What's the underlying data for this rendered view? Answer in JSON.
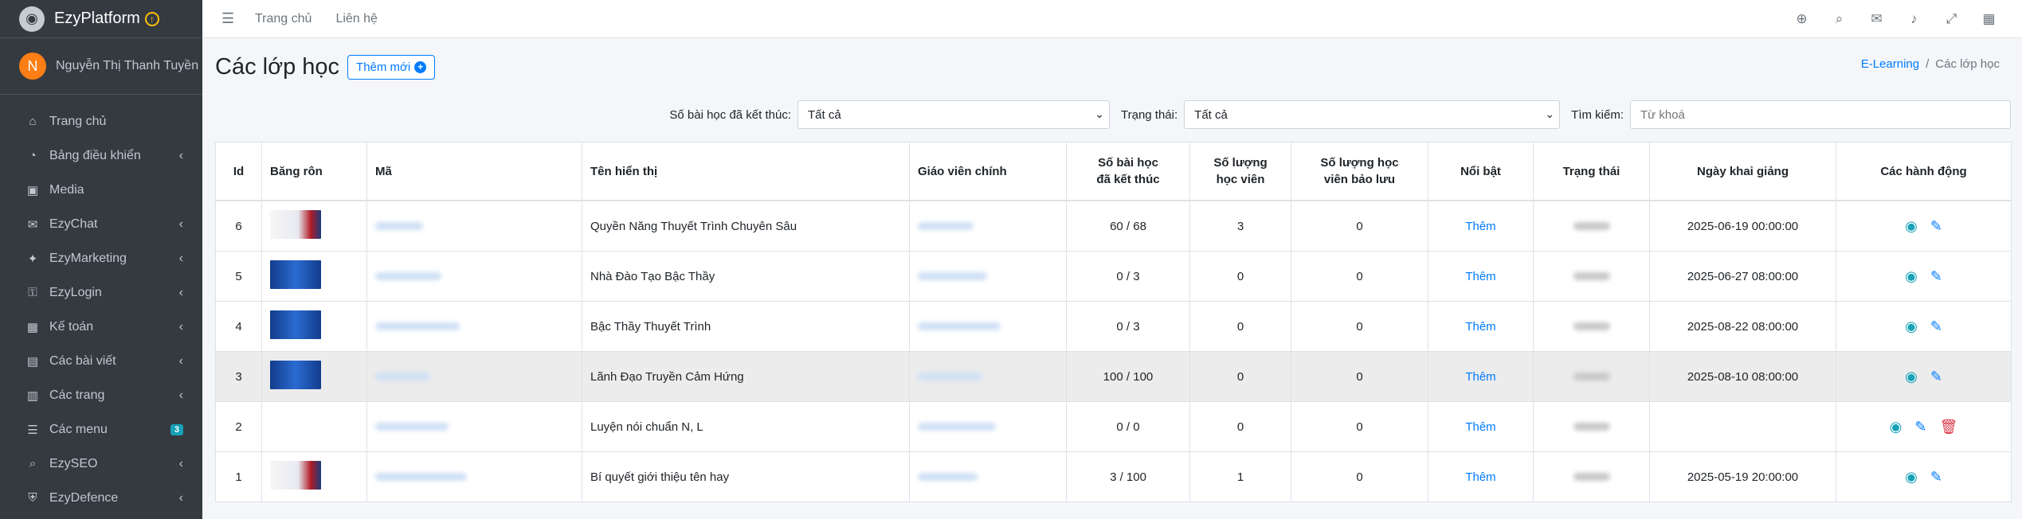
{
  "brand": {
    "name": "EzyPlatform",
    "badge": "↑"
  },
  "user": {
    "initial": "N",
    "name": "Nguyễn Thị Thanh Tuyền"
  },
  "sidebar": {
    "items": [
      {
        "label": "Trang chủ",
        "icon": "home-icon",
        "glyph": "⌂",
        "chevron": false
      },
      {
        "label": "Bảng điều khiển",
        "icon": "dashboard-icon",
        "glyph": "◔",
        "chevron": true
      },
      {
        "label": "Media",
        "icon": "image-icon",
        "glyph": "▣",
        "chevron": false
      },
      {
        "label": "EzyChat",
        "icon": "chat-icon",
        "glyph": "✉",
        "chevron": true
      },
      {
        "label": "EzyMarketing",
        "icon": "megaphone-icon",
        "glyph": "✦",
        "chevron": true
      },
      {
        "label": "EzyLogin",
        "icon": "user-lock-icon",
        "glyph": "⚿",
        "chevron": true
      },
      {
        "label": "Kế toán",
        "icon": "calculator-icon",
        "glyph": "▦",
        "chevron": true
      },
      {
        "label": "Các bài viết",
        "icon": "article-icon",
        "glyph": "▤",
        "chevron": true
      },
      {
        "label": "Các trang",
        "icon": "pages-icon",
        "glyph": "▥",
        "chevron": true
      },
      {
        "label": "Các menu",
        "icon": "menu-icon",
        "glyph": "☰",
        "chevron": false,
        "badge": "3"
      },
      {
        "label": "EzySEO",
        "icon": "seo-search-icon",
        "glyph": "⌕",
        "chevron": true
      },
      {
        "label": "EzyDefence",
        "icon": "shield-icon",
        "glyph": "⛨",
        "chevron": true
      }
    ]
  },
  "topbar": {
    "links": [
      "Trang chủ",
      "Liên hệ"
    ],
    "icons": [
      "globe-icon",
      "search-icon",
      "messages-icon",
      "bell-icon",
      "fullscreen-icon",
      "apps-icon"
    ]
  },
  "page": {
    "title": "Các lớp học",
    "add_label": "Thêm mới",
    "breadcrumb": {
      "parent": "E-Learning",
      "current": "Các lớp học"
    }
  },
  "filters": {
    "lessons_label": "Số bài học đã kết thúc:",
    "lessons_value": "Tất cả",
    "status_label": "Trạng thái:",
    "status_value": "Tất cả",
    "search_label": "Tìm kiếm:",
    "search_placeholder": "Từ khoá"
  },
  "table": {
    "headers": {
      "id": "Id",
      "banner": "Băng rôn",
      "code": "Mã",
      "name": "Tên hiển thị",
      "teacher": "Giáo viên chính",
      "lessons_1": "Số bài học",
      "lessons_2": "đã kết thúc",
      "students_1": "Số lượng",
      "students_2": "học viên",
      "reserved_1": "Số lượng học",
      "reserved_2": "viên bảo lưu",
      "featured": "Nổi bật",
      "status": "Trạng thái",
      "start": "Ngày khai giảng",
      "actions": "Các hành động"
    },
    "rows": [
      {
        "id": "6",
        "banner": "white",
        "name": "Quyền Năng Thuyết Trình Chuyên Sâu",
        "lessons": "60 / 68",
        "students": "3",
        "reserved": "0",
        "featured": "Thêm",
        "start": "2025-06-19 00:00:00",
        "delete": false
      },
      {
        "id": "5",
        "banner": "blue",
        "name": "Nhà Đào Tạo Bậc Thầy",
        "lessons": "0 / 3",
        "students": "0",
        "reserved": "0",
        "featured": "Thêm",
        "start": "2025-06-27 08:00:00",
        "delete": false
      },
      {
        "id": "4",
        "banner": "blue",
        "name": "Bậc Thầy Thuyết Trình",
        "lessons": "0 / 3",
        "students": "0",
        "reserved": "0",
        "featured": "Thêm",
        "start": "2025-08-22 08:00:00",
        "delete": false
      },
      {
        "id": "3",
        "banner": "blue",
        "name": "Lãnh Đạo Truyền Cảm Hứng",
        "lessons": "100 / 100",
        "students": "0",
        "reserved": "0",
        "featured": "Thêm",
        "start": "2025-08-10 08:00:00",
        "delete": false,
        "hover": true
      },
      {
        "id": "2",
        "banner": "",
        "name": "Luyện nói chuẩn N, L",
        "lessons": "0 / 0",
        "students": "0",
        "reserved": "0",
        "featured": "Thêm",
        "start": "",
        "delete": true
      },
      {
        "id": "1",
        "banner": "white",
        "name": "Bí quyết giới thiệu tên hay",
        "lessons": "3 / 100",
        "students": "1",
        "reserved": "0",
        "featured": "Thêm",
        "start": "2025-05-19 20:00:00",
        "delete": false
      }
    ]
  }
}
